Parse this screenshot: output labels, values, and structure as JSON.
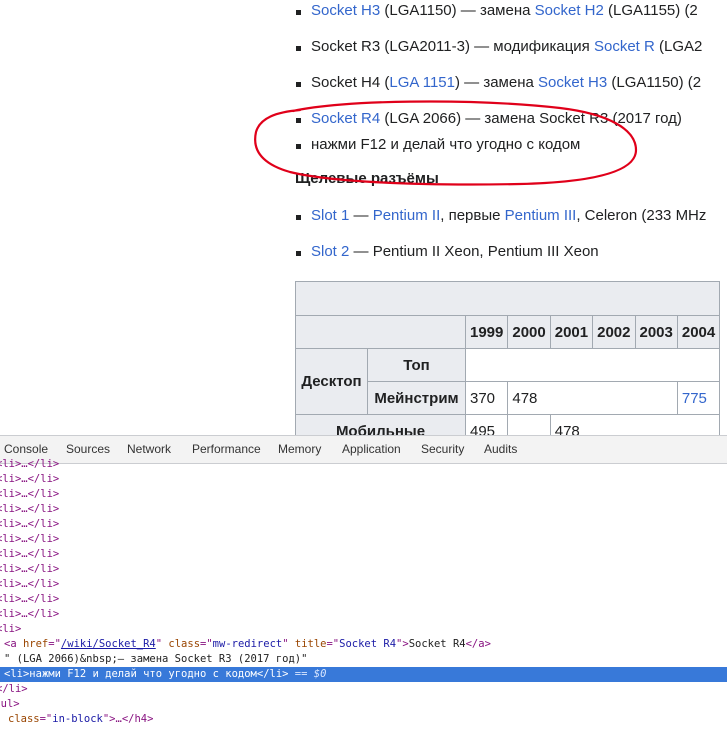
{
  "article": {
    "bullets": [
      {
        "parts": [
          {
            "t": "Socket H3",
            "link": true
          },
          {
            "t": " (LGA1150) — замена ",
            "link": false
          },
          {
            "t": "Socket H2",
            "link": true
          },
          {
            "t": " (LGA1155) (2",
            "link": false
          }
        ]
      },
      {
        "parts": [
          {
            "t": "Socket R3 (LGA2011-3) — модификация ",
            "link": false
          },
          {
            "t": "Socket R",
            "link": true
          },
          {
            "t": " (LGA2",
            "link": false
          }
        ]
      },
      {
        "parts": [
          {
            "t": "Socket H4 (",
            "link": false
          },
          {
            "t": "LGA 1151",
            "link": true
          },
          {
            "t": ") — замена ",
            "link": false
          },
          {
            "t": "Socket H3",
            "link": true
          },
          {
            "t": " (LGA1150) (2",
            "link": false
          }
        ]
      },
      {
        "parts": [
          {
            "t": "Socket R4",
            "link": true
          },
          {
            "t": " (LGA 2066) — замена Socket R3 (2017 год)",
            "link": false
          }
        ]
      },
      {
        "parts": [
          {
            "t": "нажми F12 и делай что угодно с кодом",
            "link": false
          }
        ]
      }
    ],
    "section_heading": "Щелевые разъёмы",
    "slot_bullets": [
      {
        "parts": [
          {
            "t": "Slot 1",
            "link": true
          },
          {
            "t": " — ",
            "link": false
          },
          {
            "t": "Pentium II",
            "link": true
          },
          {
            "t": ", первые ",
            "link": false
          },
          {
            "t": "Pentium III",
            "link": true
          },
          {
            "t": ", Celeron (233 MHz",
            "link": false
          }
        ]
      },
      {
        "parts": [
          {
            "t": "Slot 2",
            "link": true
          },
          {
            "t": " — Pentium II Xeon, Pentium III Xeon",
            "link": false
          }
        ]
      }
    ],
    "annotation_color": "#e0001a",
    "table": {
      "years": [
        "1999",
        "2000",
        "2001",
        "2002",
        "2003",
        "2004"
      ],
      "row_group": "Десктоп",
      "row_top": "Топ",
      "row_main": "Мейнстрим",
      "main_values": [
        "370",
        "478",
        "",
        "",
        "",
        "775"
      ],
      "next_row_label": "Мобильные",
      "next_row_values": [
        "495",
        "",
        "478"
      ]
    }
  },
  "devtools": {
    "tabs": [
      "Console",
      "Sources",
      "Network",
      "Performance",
      "Memory",
      "Application",
      "Security",
      "Audits"
    ],
    "collapsed_li": "<li>…</li>",
    "collapsed_count": 11,
    "open_li": "<li>",
    "anchor": {
      "open": "<a ",
      "href_name": "href",
      "href_value": "/wiki/Socket_R4",
      "class_name": "class",
      "class_value": "mw-redirect",
      "title_name": "title",
      "title_value": "Socket R4",
      "text": "Socket R4",
      "close": "</a>"
    },
    "text_node": "\" (LGA 2066)&nbsp;— замена Socket R3 (2017 год)\"",
    "selected": {
      "open": "<li>",
      "text": "нажми F12 и делай что угодно с кодом",
      "close": "</li>",
      "eq": " == $0"
    },
    "closing_li": "</li>",
    "closing_ul": "</ul>",
    "h4_line": {
      "attr_name": "class",
      "attr_value": "in-block",
      "rest": ">…</h4>"
    }
  }
}
